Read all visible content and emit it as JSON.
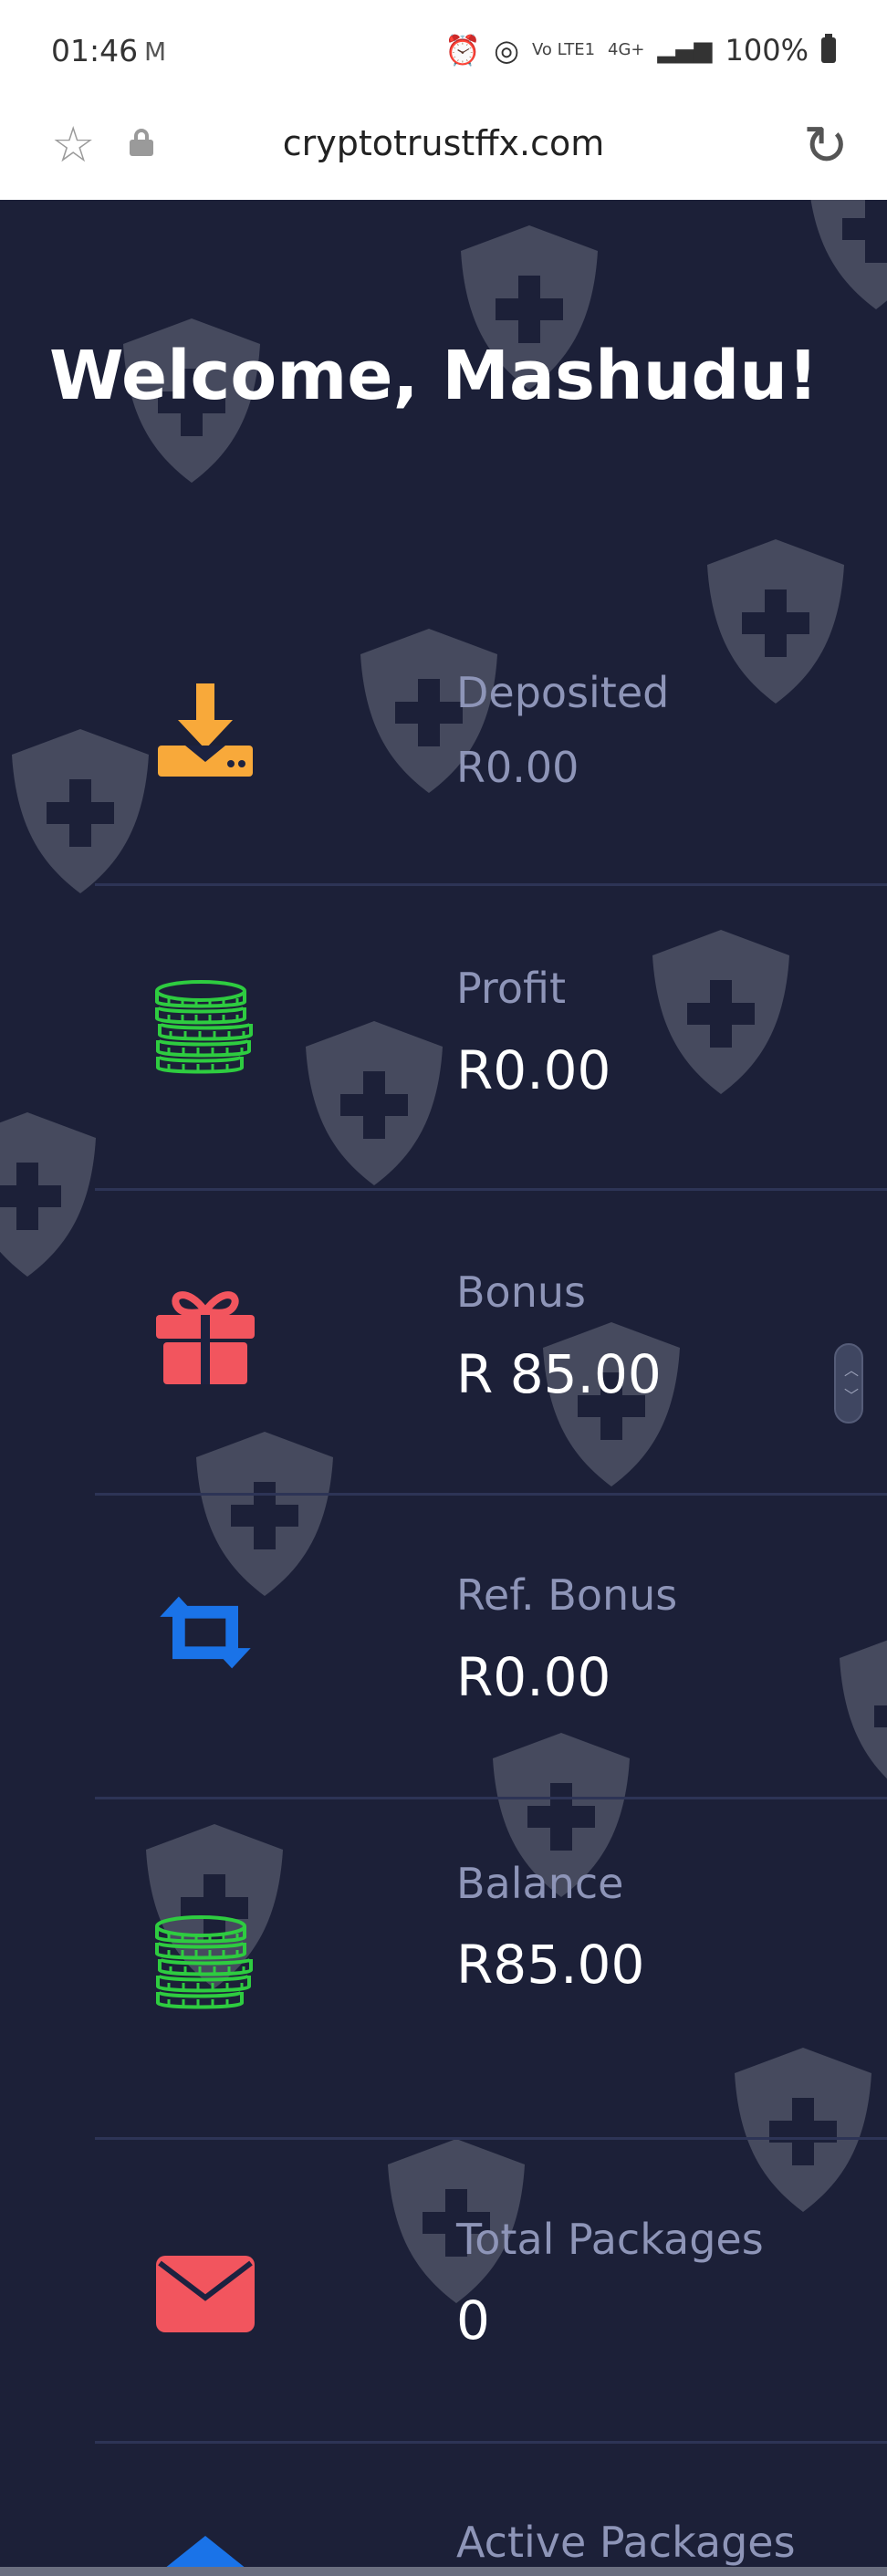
{
  "status_bar": {
    "time": "01:46",
    "mail_icon": "gmail-icon",
    "network_small": "Vo LTE1",
    "network_4g": "4G+",
    "battery_percent": "100%"
  },
  "browser": {
    "url": "cryptotrustffx.com",
    "star_icon": "star-icon",
    "lock_icon": "lock-icon",
    "reload_icon": "reload-icon"
  },
  "page": {
    "welcome": "Welcome, Mashudu!"
  },
  "stats": [
    {
      "label": "Deposited",
      "value": "R0.00",
      "icon": "download-icon",
      "icon_color": "#f8a93a"
    },
    {
      "label": "Profit",
      "value": "R0.00",
      "icon": "coins-icon",
      "icon_color": "#2ecc40"
    },
    {
      "label": "Bonus",
      "value": "R 85.00",
      "icon": "gift-icon",
      "icon_color": "#f2555e"
    },
    {
      "label": "Ref. Bonus",
      "value": "R0.00",
      "icon": "retweet-icon",
      "icon_color": "#1a73e8"
    },
    {
      "label": "Balance",
      "value": "R85.00",
      "icon": "coins-icon",
      "icon_color": "#2ecc40"
    },
    {
      "label": "Total Packages",
      "value": "0",
      "icon": "envelope-icon",
      "icon_color": "#f2555e"
    },
    {
      "label": "Active Packages",
      "value": "",
      "icon": "arrow-up-icon",
      "icon_color": "#1a73e8"
    }
  ],
  "colors": {
    "background": "#1c2038",
    "label": "#8e95b8",
    "value": "#ffffff",
    "watermark": "#8a8f9c"
  }
}
